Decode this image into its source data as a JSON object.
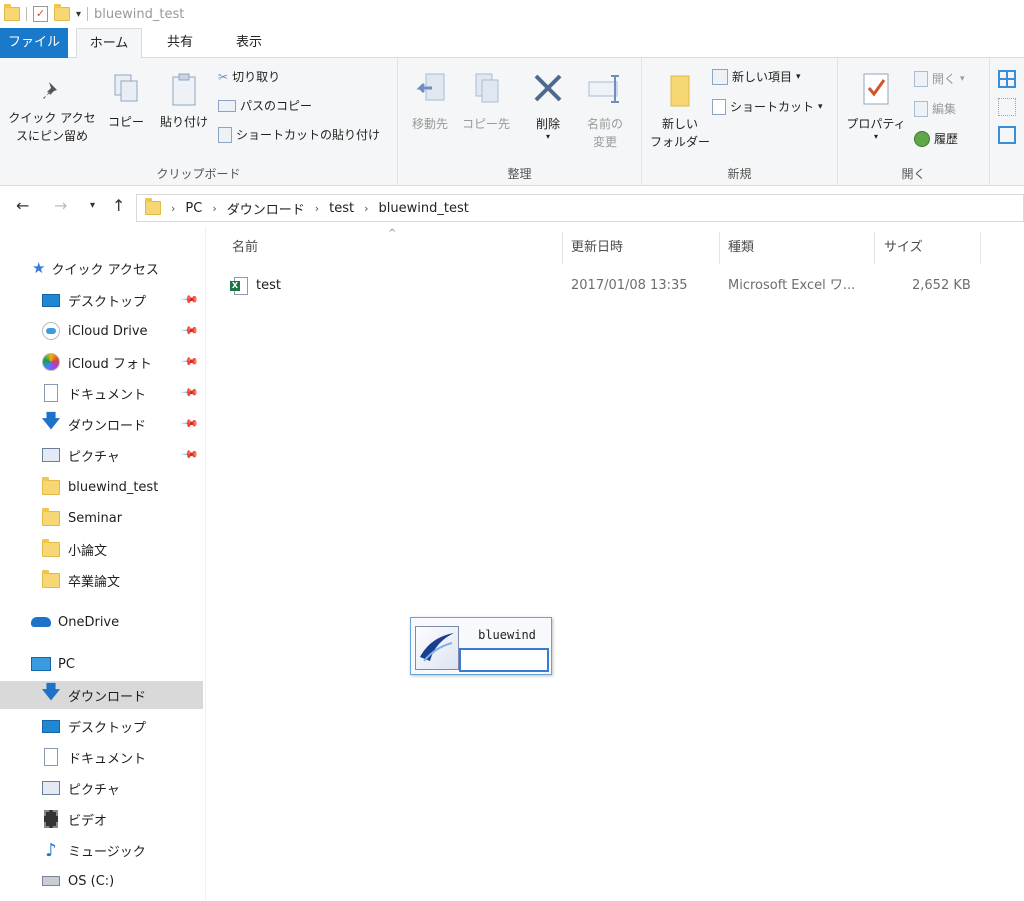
{
  "window": {
    "title": "bluewind_test"
  },
  "tabs": [
    "ファイル",
    "ホーム",
    "共有",
    "表示"
  ],
  "ribbon": {
    "clipboard": {
      "pin_line1": "クイック アクセ",
      "pin_line2": "スにピン留め",
      "copy": "コピー",
      "paste": "貼り付け",
      "cut": "切り取り",
      "copy_path": "パスのコピー",
      "paste_shortcut": "ショートカットの貼り付け",
      "label": "クリップボード"
    },
    "organize": {
      "move_to": "移動先",
      "copy_to": "コピー先",
      "delete": "削除",
      "rename_line1": "名前の",
      "rename_line2": "変更",
      "label": "整理"
    },
    "new": {
      "new_folder_line1": "新しい",
      "new_folder_line2": "フォルダー",
      "new_item": "新しい項目",
      "shortcut": "ショートカット",
      "label": "新規"
    },
    "open": {
      "properties": "プロパティ",
      "open": "開く",
      "edit": "編集",
      "history": "履歴",
      "label": "開く"
    }
  },
  "address": {
    "parts": [
      "PC",
      "ダウンロード",
      "test",
      "bluewind_test"
    ]
  },
  "nav": {
    "quick_access": "クイック アクセス",
    "items": [
      {
        "label": "デスクトップ",
        "pinned": true
      },
      {
        "label": "iCloud Drive",
        "pinned": true
      },
      {
        "label": "iCloud フォト",
        "pinned": true
      },
      {
        "label": "ドキュメント",
        "pinned": true
      },
      {
        "label": "ダウンロード",
        "pinned": true
      },
      {
        "label": "ピクチャ",
        "pinned": true
      },
      {
        "label": "bluewind_test",
        "pinned": false
      },
      {
        "label": "Seminar",
        "pinned": false
      },
      {
        "label": "小論文",
        "pinned": false
      },
      {
        "label": "卒業論文",
        "pinned": false
      }
    ],
    "onedrive": "OneDrive",
    "pc": "PC",
    "pc_items": [
      "ダウンロード",
      "デスクトップ",
      "ドキュメント",
      "ピクチャ",
      "ビデオ",
      "ミュージック",
      "OS (C:)"
    ]
  },
  "columns": {
    "name": "名前",
    "date": "更新日時",
    "type": "種類",
    "size": "サイズ"
  },
  "files": [
    {
      "name": "test",
      "date": "2017/01/08 13:35",
      "type": "Microsoft Excel ワ...",
      "size": "2,652 KB"
    }
  ],
  "popup": {
    "title": "bluewind",
    "input_value": ""
  },
  "colors": {
    "accent": "#1979ca",
    "folder": "#f7d774",
    "selection": "#d9d9d9"
  }
}
